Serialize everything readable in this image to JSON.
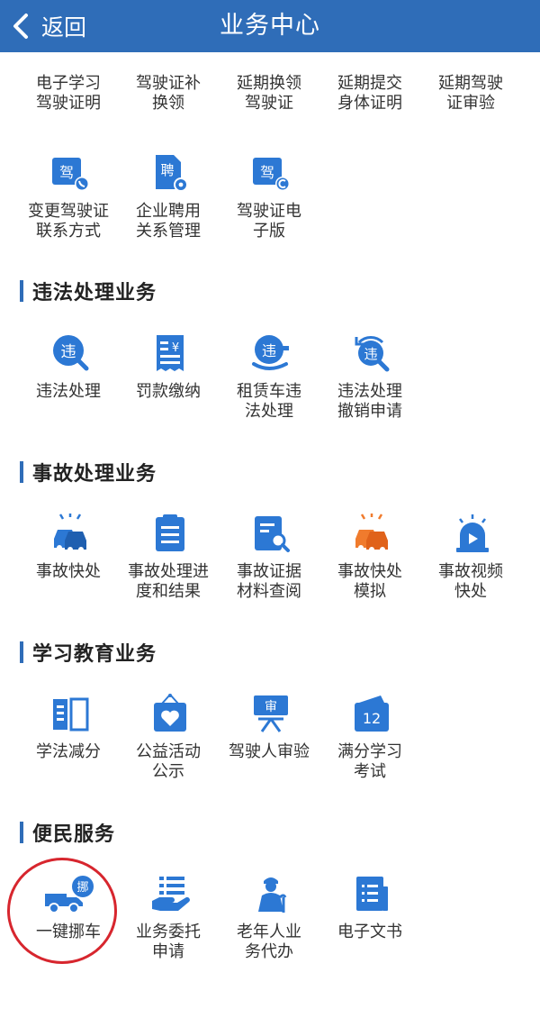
{
  "header": {
    "back_label": "返回",
    "title": "业务中心"
  },
  "colors": {
    "header": "#2f6db8",
    "icon_blue": "#2c78d4",
    "icon_orange": "#f07b2d",
    "highlight": "#d7262e"
  },
  "licenses_row1": [
    {
      "l1": "电子学习",
      "l2": "驾驶证明"
    },
    {
      "l1": "驾驶证补",
      "l2": "换领"
    },
    {
      "l1": "延期换领",
      "l2": "驾驶证"
    },
    {
      "l1": "延期提交",
      "l2": "身体证明"
    },
    {
      "l1": "延期驾驶",
      "l2": "证审验"
    }
  ],
  "licenses_row2": [
    {
      "l1": "变更驾驶证",
      "l2": "联系方式",
      "glyph": "驾"
    },
    {
      "l1": "企业聘用",
      "l2": "关系管理",
      "glyph": "聘"
    },
    {
      "l1": "驾驶证电",
      "l2": "子版",
      "glyph": "驾"
    }
  ],
  "violation": {
    "title": "违法处理业务",
    "items": [
      {
        "l1": "违法处理",
        "l2": "",
        "glyph": "违"
      },
      {
        "l1": "罚款缴纳",
        "l2": "",
        "glyph": "¥"
      },
      {
        "l1": "租赁车违",
        "l2": "法处理",
        "glyph": "违"
      },
      {
        "l1": "违法处理",
        "l2": "撤销申请",
        "glyph": "违"
      }
    ]
  },
  "accident": {
    "title": "事故处理业务",
    "items": [
      {
        "l1": "事故快处",
        "l2": ""
      },
      {
        "l1": "事故处理进",
        "l2": "度和结果"
      },
      {
        "l1": "事故证据",
        "l2": "材料查阅"
      },
      {
        "l1": "事故快处",
        "l2": "模拟"
      },
      {
        "l1": "事故视频",
        "l2": "快处"
      }
    ]
  },
  "education": {
    "title": "学习教育业务",
    "items": [
      {
        "l1": "学法减分",
        "l2": ""
      },
      {
        "l1": "公益活动",
        "l2": "公示"
      },
      {
        "l1": "驾驶人审验",
        "l2": "",
        "glyph": "审"
      },
      {
        "l1": "满分学习",
        "l2": "考试",
        "glyph": "12"
      }
    ]
  },
  "convenience": {
    "title": "便民服务",
    "items": [
      {
        "l1": "一键挪车",
        "l2": "",
        "glyph": "挪"
      },
      {
        "l1": "业务委托",
        "l2": "申请"
      },
      {
        "l1": "老年人业",
        "l2": "务代办"
      },
      {
        "l1": "电子文书",
        "l2": ""
      }
    ]
  }
}
